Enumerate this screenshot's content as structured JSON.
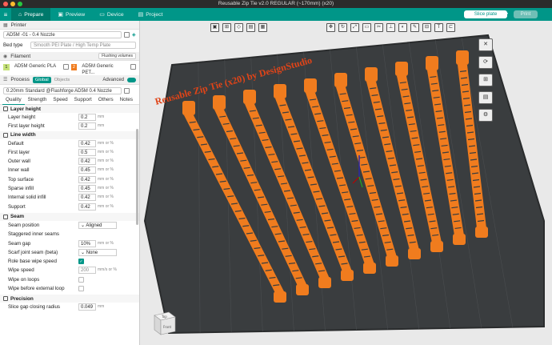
{
  "window": {
    "title": "Reusable Zip Tie v2.0 REGULAR (~170mm) (x20)"
  },
  "nav": {
    "tabs": [
      {
        "label": "Prepare",
        "icon": "home-icon",
        "active": true
      },
      {
        "label": "Preview",
        "icon": "preview-icon",
        "active": false
      },
      {
        "label": "Device",
        "icon": "device-icon",
        "active": false
      },
      {
        "label": "Project",
        "icon": "project-icon",
        "active": false
      }
    ],
    "slice_label": "Slice plate",
    "print_label": "Print"
  },
  "printer": {
    "section_label": "Printer",
    "name": "AD5M -01 - 0.4 Nozzle",
    "bed_type_label": "Bed type",
    "bed_type_value": "Smooth PEI Plate / High Temp Plate"
  },
  "filament": {
    "section_label": "Filament",
    "flushing_label": "Flushing volumes",
    "slots": [
      {
        "num": "1",
        "name": "AD5M Generic PLA",
        "color": "#c6e37a"
      },
      {
        "num": "2",
        "name": "AD5M Generic PET...",
        "color": "#f07c1e"
      }
    ]
  },
  "process": {
    "section_label": "Process",
    "global_label": "Global",
    "objects_label": "Objects",
    "advanced_label": "Advanced",
    "profile": "0.20mm Standard @Flashforge AD5M 0.4 Nozzle"
  },
  "quality_tabs": [
    "Quality",
    "Strength",
    "Speed",
    "Support",
    "Others",
    "Notes"
  ],
  "groups": {
    "layer_height": {
      "title": "Layer height",
      "params": [
        {
          "label": "Layer height",
          "value": "0.2",
          "unit": "mm"
        },
        {
          "label": "First layer height",
          "value": "0.2",
          "unit": "mm"
        }
      ]
    },
    "line_width": {
      "title": "Line width",
      "params": [
        {
          "label": "Default",
          "value": "0.42",
          "unit": "mm or %"
        },
        {
          "label": "First layer",
          "value": "0.5",
          "unit": "mm or %"
        },
        {
          "label": "Outer wall",
          "value": "0.42",
          "unit": "mm or %"
        },
        {
          "label": "Inner wall",
          "value": "0.45",
          "unit": "mm or %"
        },
        {
          "label": "Top surface",
          "value": "0.42",
          "unit": "mm or %"
        },
        {
          "label": "Sparse infill",
          "value": "0.45",
          "unit": "mm or %"
        },
        {
          "label": "Internal solid infill",
          "value": "0.42",
          "unit": "mm or %"
        },
        {
          "label": "Support",
          "value": "0.42",
          "unit": "mm or %"
        }
      ]
    },
    "seam": {
      "title": "Seam",
      "seam_position_label": "Seam position",
      "seam_position_value": "Aligned",
      "staggered_label": "Staggered inner seams",
      "seam_gap_label": "Seam gap",
      "seam_gap_value": "10%",
      "seam_gap_unit": "mm or %",
      "scarf_label": "Scarf joint seam (beta)",
      "scarf_value": "None",
      "role_wipe_label": "Role base wipe speed",
      "wipe_speed_label": "Wipe speed",
      "wipe_speed_value": "200",
      "wipe_speed_unit": "mm/s or %",
      "wipe_loops_label": "Wipe on loops",
      "wipe_before_label": "Wipe before external loop"
    },
    "precision": {
      "title": "Precision",
      "slice_gap_label": "Slice gap closing radius",
      "slice_gap_value": "0.049",
      "slice_gap_unit": "mm"
    }
  },
  "plate": {
    "overlay_text": "Reusable Zip Tie (x20) by DesignStudio",
    "part_color": "#f07c1e",
    "plate_color": "#3a3d3f"
  },
  "cube": {
    "top": "Top",
    "front": "Front"
  }
}
